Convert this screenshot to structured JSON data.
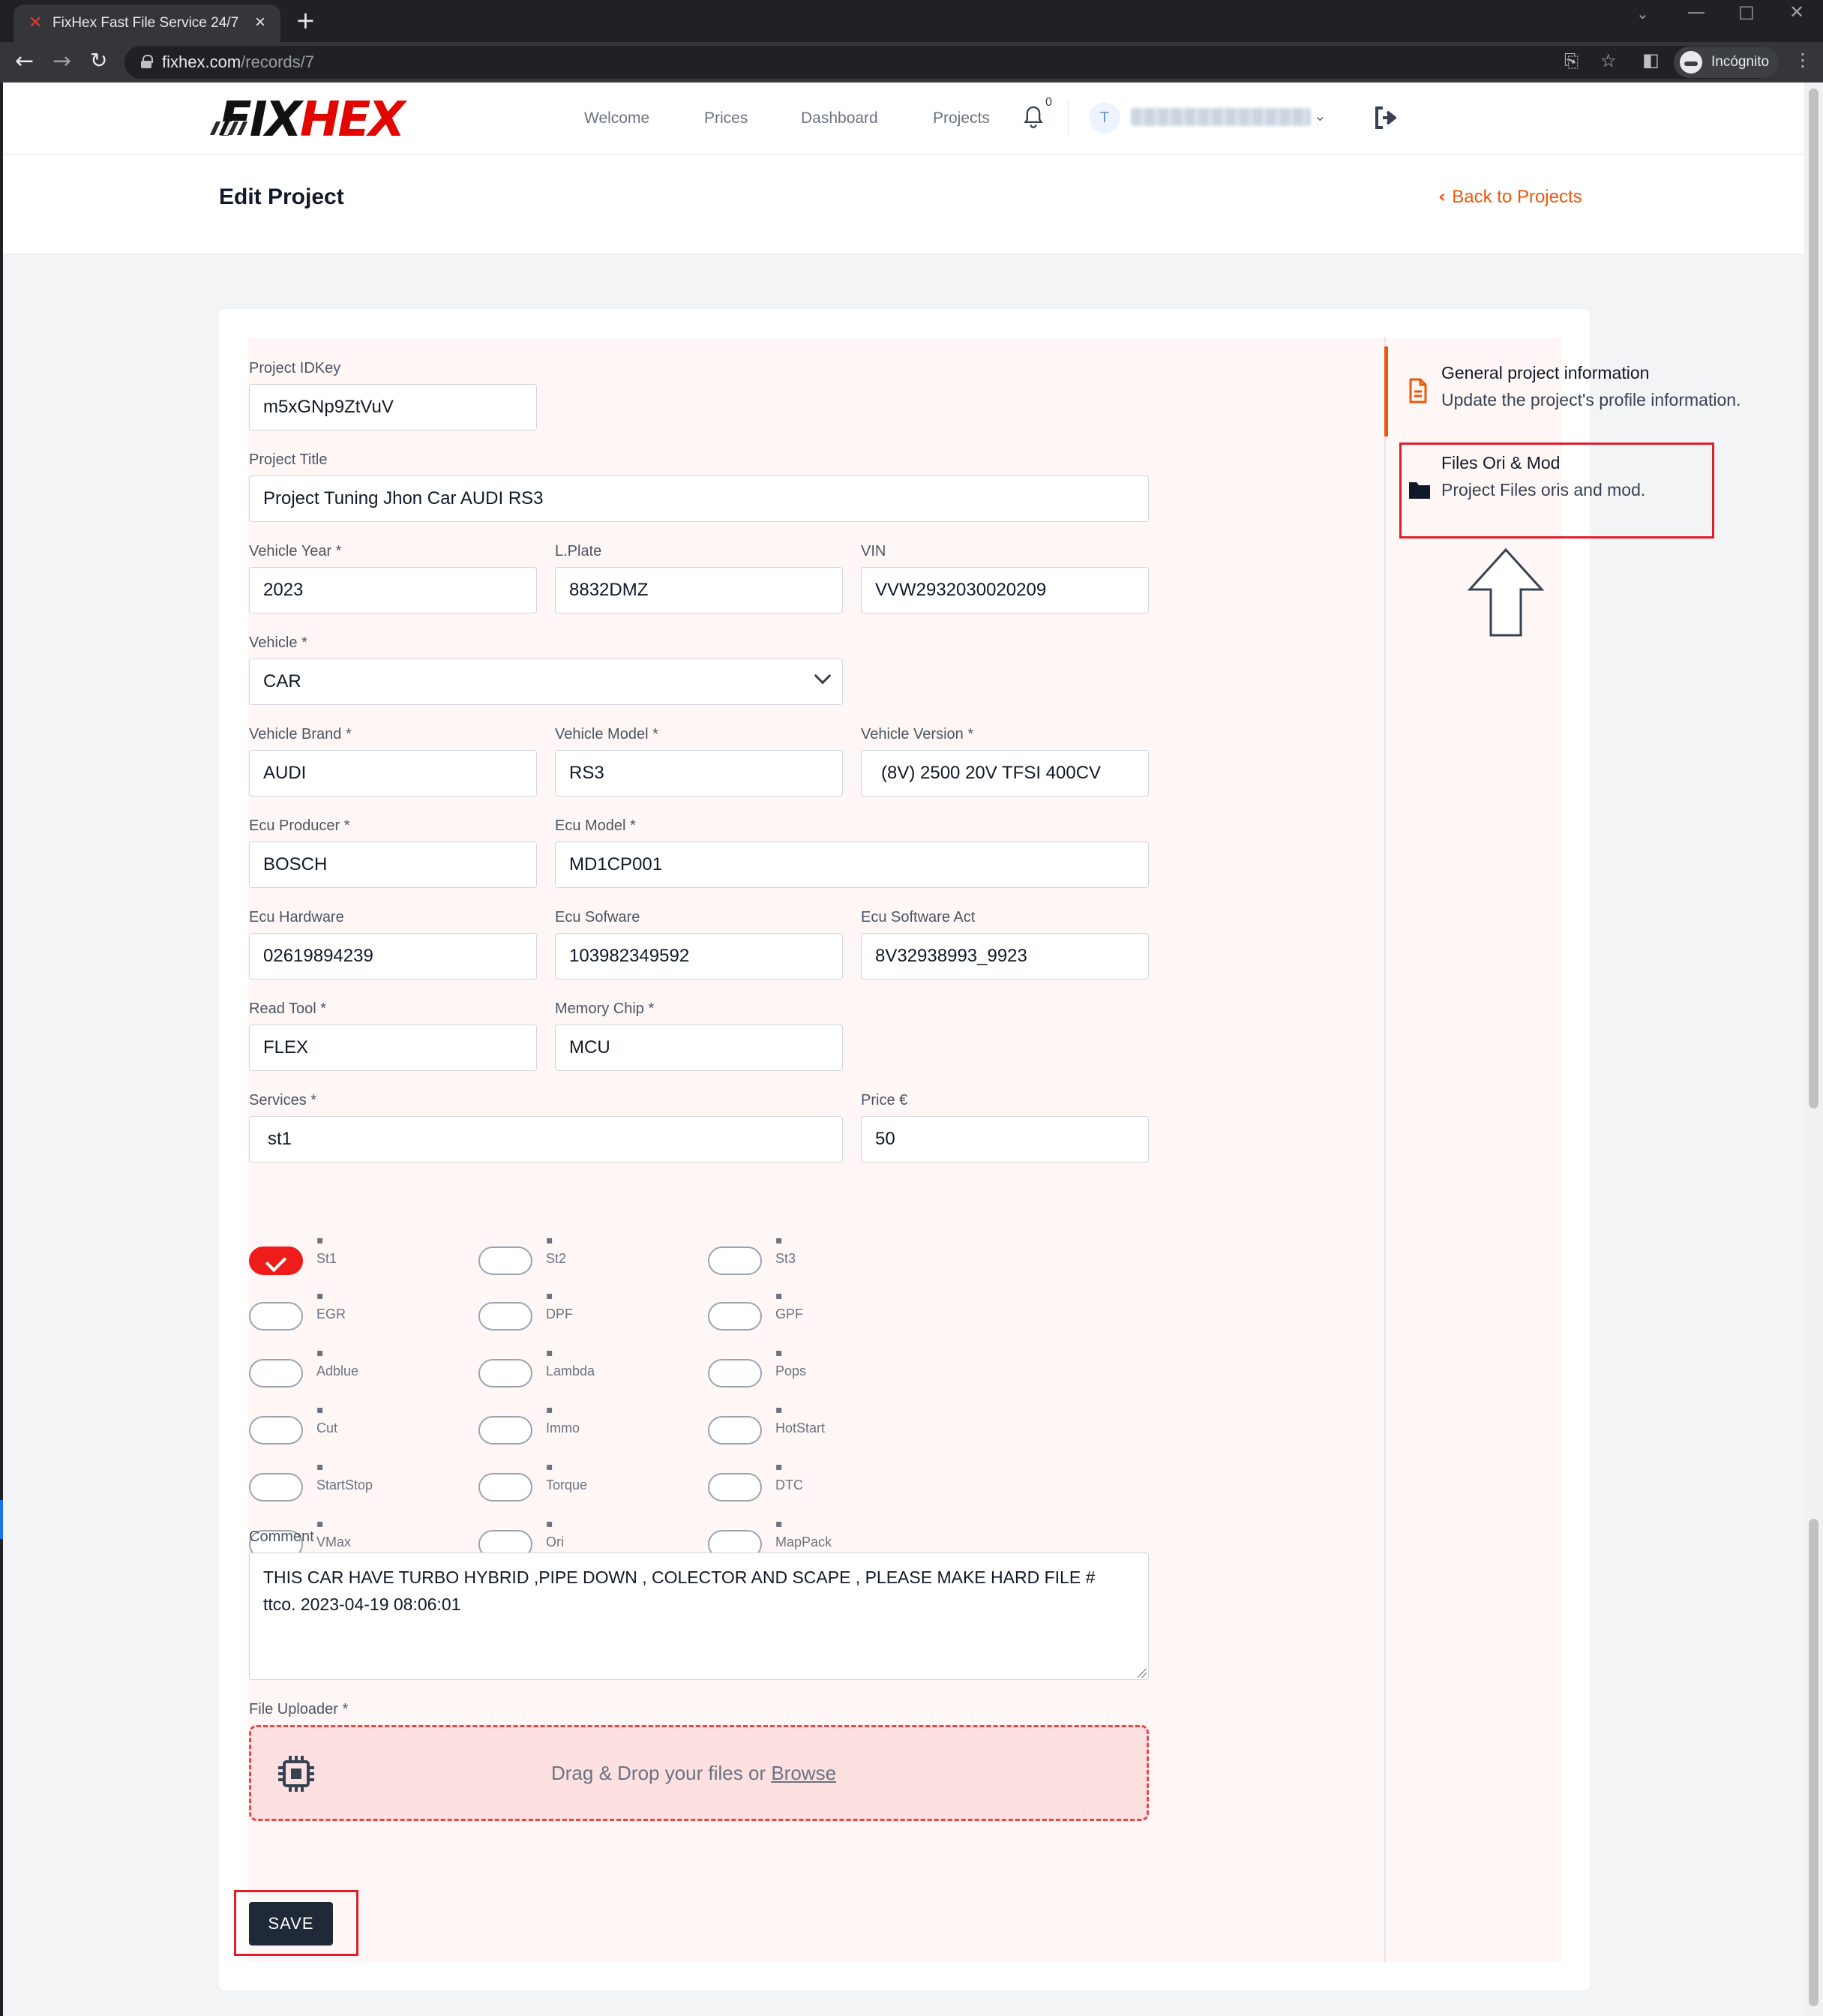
{
  "browser": {
    "tab_title": "FixHex Fast File Service 24/7",
    "url_host": "fixhex.com",
    "url_path": "/records/7",
    "profile_label": "Incógnito"
  },
  "nav": {
    "logo_left": "FIX",
    "logo_right": "HEX",
    "links": [
      "Welcome",
      "Prices",
      "Dashboard",
      "Projects"
    ],
    "notification_count": "0",
    "avatar_initial": "T"
  },
  "header": {
    "title": "Edit Project",
    "back_label": "Back to Projects"
  },
  "form": {
    "project_idkey": {
      "label": "Project IDKey",
      "value": "m5xGNp9ZtVuV"
    },
    "project_title": {
      "label": "Project Title",
      "value": "Project Tuning Jhon Car AUDI RS3"
    },
    "vehicle_year": {
      "label": "Vehicle Year *",
      "value": "2023"
    },
    "lplate": {
      "label": "L.Plate",
      "value": "8832DMZ"
    },
    "vin": {
      "label": "VIN",
      "value": "VVW2932030020209"
    },
    "vehicle": {
      "label": "Vehicle *",
      "value": "CAR"
    },
    "vehicle_brand": {
      "label": "Vehicle Brand *",
      "value": "AUDI"
    },
    "vehicle_model": {
      "label": "Vehicle Model *",
      "value": "RS3"
    },
    "vehicle_version": {
      "label": "Vehicle Version *",
      "value": "(8V) 2500 20V TFSI 400CV"
    },
    "ecu_producer": {
      "label": "Ecu Producer *",
      "value": "BOSCH"
    },
    "ecu_model": {
      "label": "Ecu Model *",
      "value": "MD1CP001"
    },
    "ecu_hardware": {
      "label": "Ecu Hardware",
      "value": "02619894239"
    },
    "ecu_software": {
      "label": "Ecu Sofware",
      "value": "103982349592"
    },
    "ecu_software_act": {
      "label": "Ecu Software Act",
      "value": "8V32938993_9923"
    },
    "read_tool": {
      "label": "Read Tool *",
      "value": "FLEX"
    },
    "memory_chip": {
      "label": "Memory Chip *",
      "value": "MCU"
    },
    "services": {
      "label": "Services *",
      "value": "st1"
    },
    "price": {
      "label": "Price €",
      "value": "50"
    },
    "service_toggles": [
      {
        "label": "St1",
        "on": true,
        "icon": "chip-icon"
      },
      {
        "label": "St2",
        "on": false,
        "icon": "chip-icon"
      },
      {
        "label": "St3",
        "on": false,
        "icon": "chip-icon"
      },
      {
        "label": "EGR",
        "on": false,
        "icon": "valve-icon"
      },
      {
        "label": "DPF",
        "on": false,
        "icon": "filter-icon"
      },
      {
        "label": "GPF",
        "on": false,
        "icon": "filter-icon"
      },
      {
        "label": "Adblue",
        "on": false,
        "icon": "drop-icon"
      },
      {
        "label": "Lambda",
        "on": false,
        "icon": "sensor-icon"
      },
      {
        "label": "Pops",
        "on": false,
        "icon": "exhaust-icon"
      },
      {
        "label": "Cut",
        "on": false,
        "icon": "clock-icon"
      },
      {
        "label": "Immo",
        "on": false,
        "icon": "key-icon"
      },
      {
        "label": "HotStart",
        "on": false,
        "icon": "thermometer-icon"
      },
      {
        "label": "StartStop",
        "on": false,
        "icon": "power-icon"
      },
      {
        "label": "Torque",
        "on": false,
        "icon": "gauge-icon"
      },
      {
        "label": "DTC",
        "on": false,
        "icon": "engine-icon"
      },
      {
        "label": "VMax",
        "on": false,
        "icon": "speed-icon"
      },
      {
        "label": "Ori",
        "on": false,
        "icon": "file-icon"
      },
      {
        "label": "MapPack",
        "on": false,
        "icon": "map-icon"
      }
    ],
    "comment": {
      "label": "Comment",
      "line1": "THIS CAR HAVE TURBO HYBRID ,PIPE DOWN , COLECTOR AND SCAPE , PLEASE MAKE HARD FILE #",
      "line2": "ttco. 2023-04-19 08:06:01"
    },
    "uploader": {
      "label": "File Uploader *",
      "text": "Drag & Drop your files or ",
      "browse": "Browse"
    },
    "save_label": "SAVE"
  },
  "sidebar": {
    "items": [
      {
        "title": "General project information",
        "subtitle": "Update the project's profile information."
      },
      {
        "title": "Files Ori & Mod",
        "subtitle": "Project Files oris and mod."
      }
    ]
  },
  "colors": {
    "accent": "#ea580c",
    "brand_red": "#e10600",
    "toggle_on": "#ef1c1c",
    "annotation_red": "#e11d2a",
    "save_button": "#1f2937"
  }
}
